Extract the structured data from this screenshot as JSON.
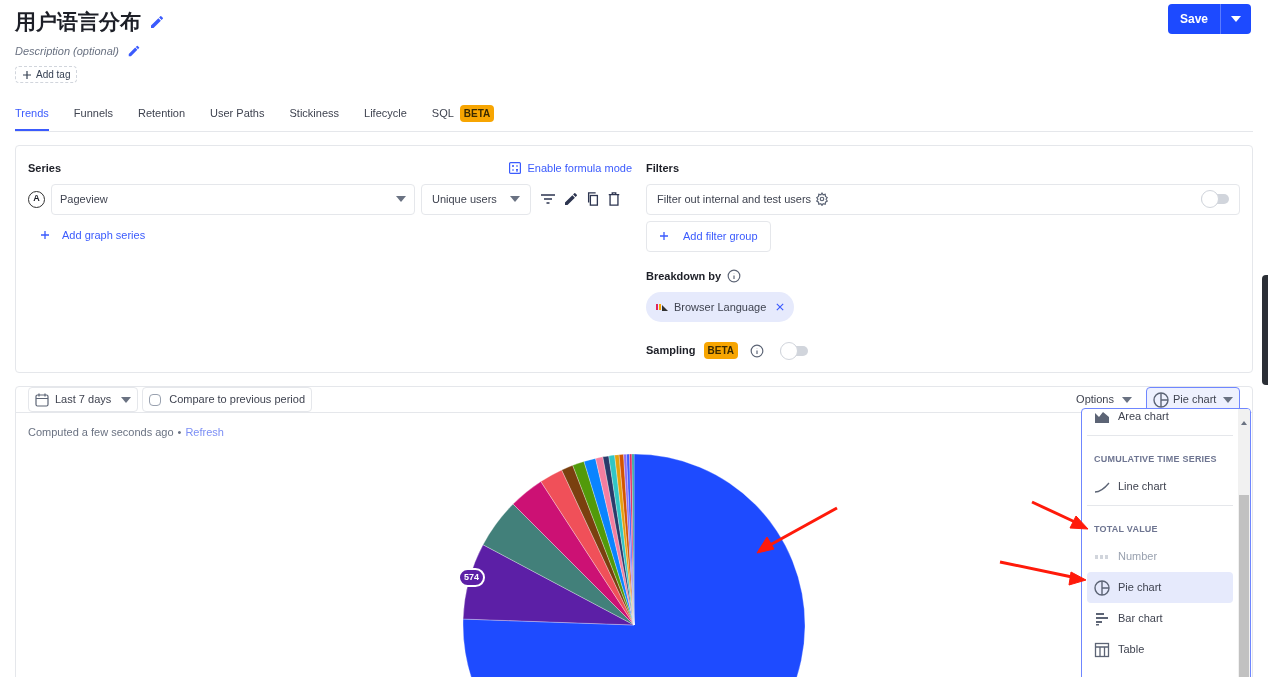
{
  "header": {
    "title": "用户语言分布",
    "description_placeholder": "Description (optional)",
    "add_tag": "Add tag",
    "save": "Save"
  },
  "tabs": [
    {
      "label": "Trends",
      "selected": true
    },
    {
      "label": "Funnels",
      "selected": false
    },
    {
      "label": "Retention",
      "selected": false
    },
    {
      "label": "User Paths",
      "selected": false
    },
    {
      "label": "Stickiness",
      "selected": false
    },
    {
      "label": "Lifecycle",
      "selected": false
    },
    {
      "label": "SQL",
      "badge": "BETA",
      "selected": false
    }
  ],
  "series": {
    "title": "Series",
    "formula_link": "Enable formula mode",
    "items": [
      {
        "letter": "A",
        "event": "Pageview",
        "math": "Unique users"
      }
    ],
    "add": "Add graph series"
  },
  "filters": {
    "title": "Filters",
    "internal_filter": {
      "label": "Filter out internal and test users",
      "on": false
    },
    "add_group": "Add filter group"
  },
  "breakdown": {
    "title": "Breakdown by",
    "chip": "Browser Language"
  },
  "sampling": {
    "title": "Sampling",
    "badge": "BETA",
    "on": false
  },
  "toolbar": {
    "date_range": "Last 7 days",
    "compare": {
      "label": "Compare to previous period",
      "checked": false
    },
    "options": "Options",
    "chart_type": "Pie chart"
  },
  "status": {
    "computed": "Computed a few seconds ago",
    "separator": "•",
    "refresh": "Refresh"
  },
  "pie_label": "574",
  "chart_menu": [
    {
      "kind": "option",
      "label": "Area chart",
      "selected": false,
      "disabled": false
    },
    {
      "kind": "header",
      "label": "CUMULATIVE TIME SERIES"
    },
    {
      "kind": "option",
      "label": "Line chart",
      "selected": false,
      "disabled": false
    },
    {
      "kind": "header",
      "label": "TOTAL VALUE"
    },
    {
      "kind": "option",
      "label": "Number",
      "selected": false,
      "disabled": true
    },
    {
      "kind": "option",
      "label": "Pie chart",
      "selected": true,
      "disabled": false
    },
    {
      "kind": "option",
      "label": "Bar chart",
      "selected": false,
      "disabled": false
    },
    {
      "kind": "option",
      "label": "Table",
      "selected": false,
      "disabled": false
    }
  ]
}
